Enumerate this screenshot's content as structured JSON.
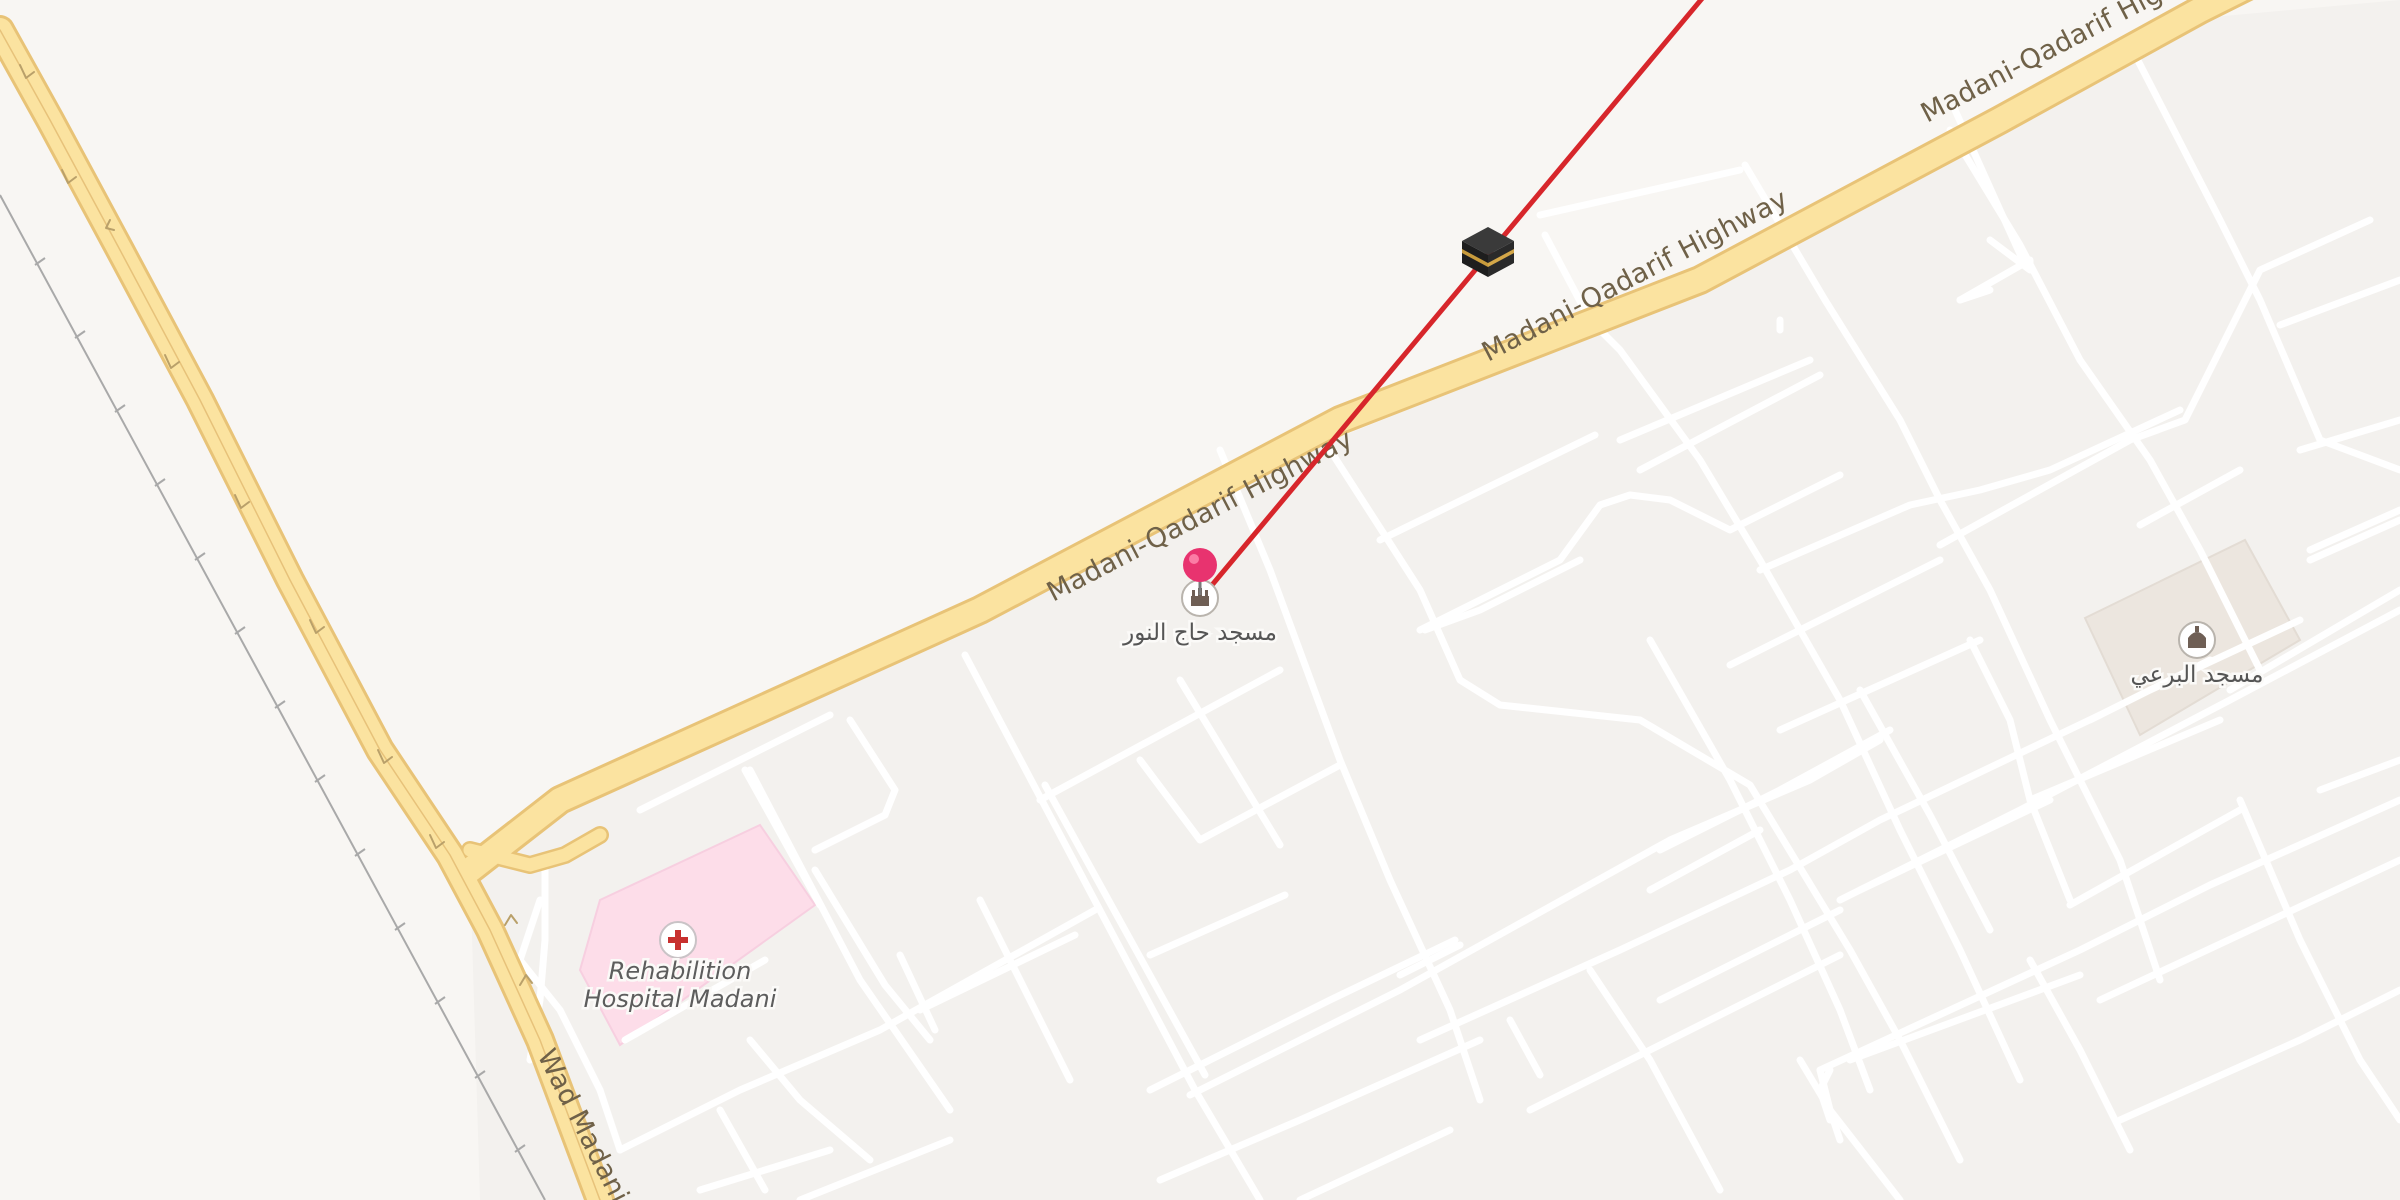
{
  "map": {
    "roads": {
      "highway_east": "Madani-Qadarif Highway",
      "highway_south": "Wad Madani-S"
    },
    "pois": [
      {
        "id": "mosque-haj-alnoor",
        "name": "مسجد حاج النور",
        "type": "mosque"
      },
      {
        "id": "mosque-albariei",
        "name": "مسجد البرعي",
        "type": "mosque"
      },
      {
        "id": "hospital",
        "name_line1": "Rehabilition",
        "name_line2": "Hospital Madani",
        "type": "hospital"
      }
    ],
    "markers": {
      "pin": "location-pin",
      "kaaba": "kaaba-icon",
      "qibla_line_color": "#d7262b"
    },
    "colors": {
      "background": "#f7f5f2",
      "block": "#f2f0ed",
      "street": "#ffffff",
      "highway_fill": "#fbe3a0",
      "highway_casing": "#e8c377",
      "hospital_area": "#fddde9",
      "mosque_area": "#ece6df",
      "pin": "#e8336f"
    }
  }
}
